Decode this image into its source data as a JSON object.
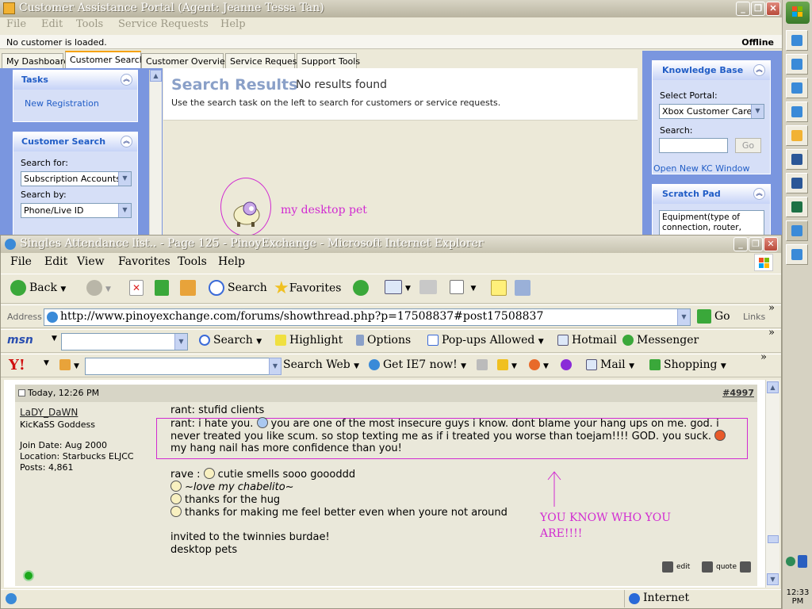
{
  "portal": {
    "title": "Customer Assistance Portal (Agent: Jeanne Tessa Tan)",
    "menu": [
      "File",
      "Edit",
      "Tools",
      "Service Requests",
      "Help"
    ],
    "status_left": "No customer is loaded.",
    "status_right": "Offline",
    "tabs": [
      "My Dashboard",
      "Customer Search",
      "Customer Overview",
      "Service Request",
      "Support Tools"
    ],
    "active_tab": "Customer Search",
    "tasks": {
      "title": "Tasks",
      "link": "New Registration"
    },
    "customer_search": {
      "title": "Customer Search",
      "search_for_label": "Search for:",
      "search_for_value": "Subscription Accounts",
      "search_by_label": "Search by:",
      "search_by_value": "Phone/Live ID"
    },
    "results": {
      "title": "Search Results",
      "subtitle": "No results found",
      "hint": "Use the search task on the left to search for customers or service requests."
    },
    "desktop_pet_label": "my desktop pet",
    "knowledge_base": {
      "title": "Knowledge Base",
      "portal_label": "Select Portal:",
      "portal_value": "Xbox Customer Care (g",
      "search_label": "Search:",
      "go_label": "Go",
      "open_link": "Open New KC Window"
    },
    "scratch_pad": {
      "title": "Scratch Pad",
      "text_line1": "Equipment(type of",
      "text_line2": "connection, router,"
    }
  },
  "ie": {
    "title": "Singles Attendance list.. - Page 125 - PinoyExchange - Microsoft Internet Explorer",
    "menu": [
      "File",
      "Edit",
      "View",
      "Favorites",
      "Tools",
      "Help"
    ],
    "toolbar": {
      "back": "Back",
      "search": "Search",
      "favorites": "Favorites"
    },
    "address_label": "Address",
    "url": "http://www.pinoyexchange.com/forums/showthread.php?p=17508837#post17508837",
    "go": "Go",
    "links": "Links",
    "msn_bar": {
      "logo": "msn",
      "search": "Search",
      "highlight": "Highlight",
      "options": "Options",
      "popups": "Pop-ups Allowed",
      "hotmail": "Hotmail",
      "messenger": "Messenger"
    },
    "yahoo_bar": {
      "logo": "Y!",
      "search_web": "Search Web",
      "ie7": "Get IE7 now!",
      "mail": "Mail",
      "shopping": "Shopping"
    },
    "status_zone": "Internet"
  },
  "post": {
    "date": "Today, 12:26 PM",
    "number": "#4997",
    "user": {
      "name": "LaDY_DaWN",
      "rank": "KicKaSS Goddess",
      "join": "Join Date: Aug 2000",
      "location": "Location: Starbucks ELJCC",
      "posts": "Posts: 4,861"
    },
    "lines": {
      "l1": "rant: stufid clients",
      "l2a": "rant: i hate you.",
      "l2b": "you are one of the most insecure guys i know. dont blame your hang ups on me. god. i",
      "l3": "never treated you like scum. so stop texting me as if i treated you worse than toejam!!!! GOD. you suck.",
      "l4": "my hang nail has more confidence than you!",
      "r1": "rave :",
      "r1b": "cutie smells sooo goooddd",
      "r2": "~love my chabelito~",
      "r3": "thanks for the hug",
      "r4": "thanks for making me feel better even when youre not around",
      "i1": "invited to the twinnies burdae!",
      "i2": "desktop pets"
    },
    "annotation": {
      "line1": "YOU KNOW WHO YOU",
      "line2": "ARE!!!!"
    },
    "edit": "edit",
    "quote": "quote"
  },
  "clock": "12:33 PM",
  "colors": {
    "annotation": "#d12bd1",
    "xp_blue": "#7a96df",
    "link": "#215dc6"
  }
}
